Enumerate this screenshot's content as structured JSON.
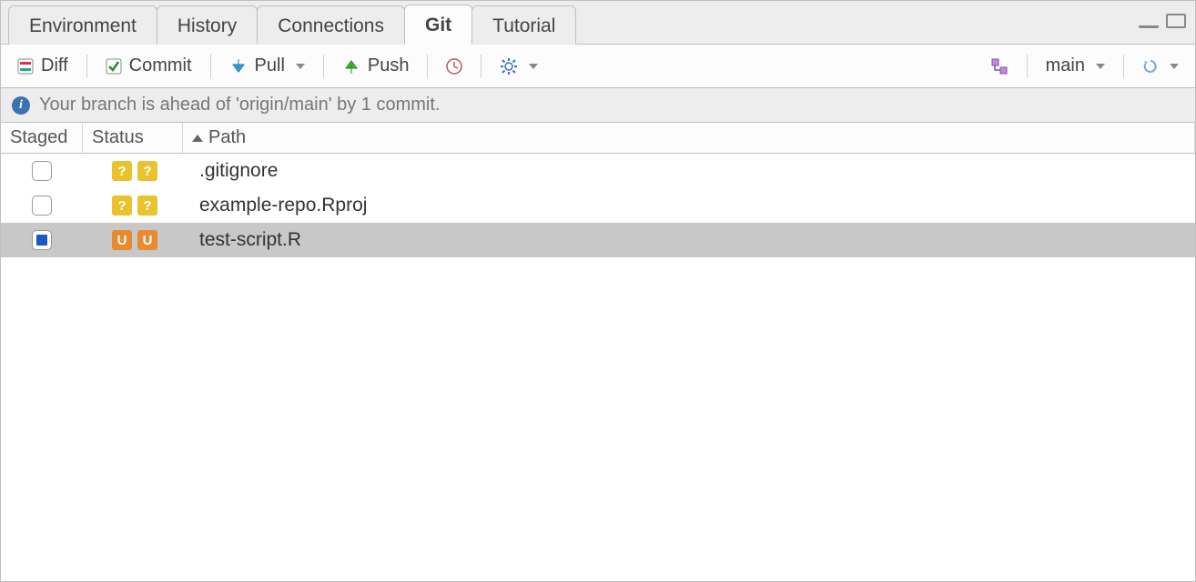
{
  "tabs": {
    "environment": "Environment",
    "history": "History",
    "connections": "Connections",
    "git": "Git",
    "tutorial": "Tutorial",
    "active": "git"
  },
  "toolbar": {
    "diff": "Diff",
    "commit": "Commit",
    "pull": "Pull",
    "push": "Push",
    "branch": "main"
  },
  "infobar": {
    "message": "Your branch is ahead of 'origin/main' by 1 commit."
  },
  "columns": {
    "staged": "Staged",
    "status": "Status",
    "path": "Path"
  },
  "files": [
    {
      "staged": false,
      "status_left": "?",
      "status_right": "?",
      "status_class": "q",
      "path": ".gitignore",
      "selected": false
    },
    {
      "staged": false,
      "status_left": "?",
      "status_right": "?",
      "status_class": "q",
      "path": "example-repo.Rproj",
      "selected": false
    },
    {
      "staged": true,
      "status_left": "U",
      "status_right": "U",
      "status_class": "u",
      "path": "test-script.R",
      "selected": true
    }
  ]
}
